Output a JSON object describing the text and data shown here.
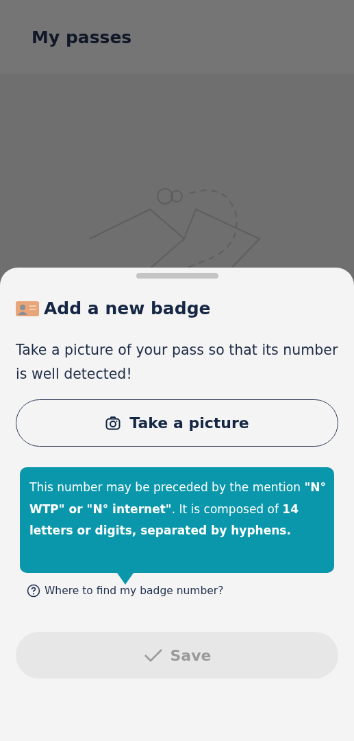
{
  "header": {
    "title": "My passes"
  },
  "sheet": {
    "title": "Add a new badge",
    "intro": "Take a picture of your pass so that its number is well detected!",
    "camera_button": {
      "label": "Take a picture"
    },
    "tooltip": {
      "text": "This number may be preceded by the mention **\"N° WTP\" or \"N° internet\"**. It is composed of **14 letters or digits, separated by hyphens.**"
    },
    "help_link": {
      "label": "Where to find my badge number?"
    },
    "save_button": {
      "label": "Save",
      "disabled": true
    }
  }
}
